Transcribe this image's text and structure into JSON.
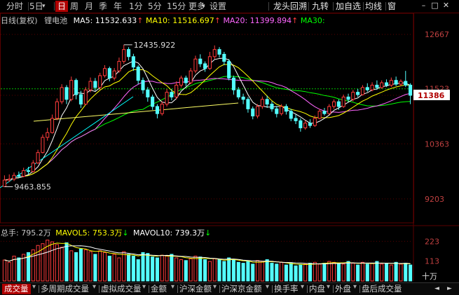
{
  "toolbar": {
    "left_items": [
      {
        "label": "分时",
        "x": 9
      },
      {
        "label": "5日",
        "x": 42
      },
      {
        "label": "日",
        "x": 79,
        "active": true
      },
      {
        "label": "周",
        "x": 100
      },
      {
        "label": "月",
        "x": 121
      },
      {
        "label": "季",
        "x": 141
      },
      {
        "label": "年",
        "x": 162
      },
      {
        "label": "1分",
        "x": 184
      },
      {
        "label": "5分",
        "x": 211
      },
      {
        "label": "15分",
        "x": 238
      },
      {
        "label": "更多",
        "x": 269
      },
      {
        "label": "设置",
        "x": 299
      }
    ],
    "right_items": [
      {
        "label": "龙头回溯",
        "x": 390
      },
      {
        "label": "九转",
        "x": 445
      },
      {
        "label": "加自选",
        "x": 479
      },
      {
        "label": "均线",
        "x": 521
      },
      {
        "label": "窗",
        "x": 553
      }
    ],
    "chevron": "▾"
  },
  "legend": {
    "title": "日线(复权)",
    "stock": "锂电池",
    "ma5_label": "MA5: 11532.633",
    "ma10_label": "MA10: 11516.697",
    "ma20_label": "MA20: 11399.894",
    "ma30_label": "MA30:",
    "arrow_up": "↑",
    "ma5_color": "#ffffff",
    "ma10_color": "#ffff00",
    "ma20_color": "#ff66ff",
    "ma30_color": "#00ff00"
  },
  "price_axis": {
    "labels": [
      "12667",
      "11386",
      "10363",
      "9203"
    ],
    "current": "11386",
    "ref_label": "11523"
  },
  "annotations": {
    "high": "12435.922",
    "low": "9463.855"
  },
  "volume_legend": {
    "total": "总手: 795.2万",
    "mavol5": "MAVOL5: 753.3万",
    "mavol10": "MAVOL10: 739.3万",
    "arrow_down": "↓",
    "axis": [
      "223",
      "113",
      "十万"
    ]
  },
  "tabs": [
    "成交量",
    "多周期成交量",
    "虚拟成交量",
    "金额",
    "沪深金额",
    "沪深京金额",
    "换手率",
    "内盘",
    "外盘",
    "盘后成交量"
  ],
  "colors": {
    "up": "#ff3c3c",
    "down": "#54ffff",
    "grid": "#5a0000",
    "axis_text": "#c04040"
  },
  "chart_data": {
    "type": "candlestick",
    "title": "锂电池",
    "y_ticks": [
      12667,
      11386,
      10363,
      9203
    ],
    "y_range": [
      8700,
      12950
    ],
    "volume_ticks": [
      223,
      113
    ],
    "volume_unit": "十万",
    "candles": [
      [
        9465,
        9600,
        9700,
        9460
      ],
      [
        9600,
        9620,
        9720,
        9560
      ],
      [
        9620,
        9700,
        9760,
        9580
      ],
      [
        9700,
        9680,
        9780,
        9640
      ],
      [
        9680,
        9800,
        9860,
        9660
      ],
      [
        9800,
        9780,
        9880,
        9720
      ],
      [
        9780,
        9960,
        10020,
        9760
      ],
      [
        9960,
        10180,
        10240,
        9940
      ],
      [
        10180,
        10500,
        10560,
        10160
      ],
      [
        10500,
        10600,
        10700,
        10430
      ],
      [
        10600,
        10900,
        10980,
        10580
      ],
      [
        10900,
        11250,
        11320,
        10860
      ],
      [
        11250,
        11550,
        11620,
        11200
      ],
      [
        11550,
        11300,
        11600,
        11200
      ],
      [
        11300,
        11700,
        11780,
        11260
      ],
      [
        11700,
        11400,
        11740,
        11300
      ],
      [
        11400,
        11200,
        11480,
        11120
      ],
      [
        11200,
        11500,
        11560,
        11180
      ],
      [
        11500,
        11680,
        11760,
        11450
      ],
      [
        11680,
        11550,
        11750,
        11480
      ],
      [
        11550,
        11800,
        11860,
        11500
      ],
      [
        11800,
        11950,
        12020,
        11760
      ],
      [
        11950,
        11750,
        11990,
        11680
      ],
      [
        11750,
        11900,
        11960,
        11700
      ],
      [
        11900,
        12100,
        12180,
        11860
      ],
      [
        12100,
        12350,
        12450,
        12050
      ],
      [
        12350,
        12200,
        12400,
        12120
      ],
      [
        12200,
        11980,
        12260,
        11900
      ],
      [
        11980,
        11700,
        12020,
        11620
      ],
      [
        11700,
        11500,
        11760,
        11420
      ],
      [
        11500,
        11350,
        11560,
        11250
      ],
      [
        11350,
        11150,
        11400,
        11080
      ],
      [
        11150,
        11000,
        11200,
        10900
      ],
      [
        11000,
        11200,
        11260,
        10960
      ],
      [
        11200,
        11450,
        11520,
        11150
      ],
      [
        11450,
        11350,
        11520,
        11280
      ],
      [
        11350,
        11600,
        11680,
        11300
      ],
      [
        11600,
        11750,
        11800,
        11550
      ],
      [
        11750,
        11650,
        11800,
        11580
      ],
      [
        11650,
        11900,
        11960,
        11620
      ],
      [
        11900,
        12150,
        12220,
        11850
      ],
      [
        12150,
        12050,
        12250,
        11980
      ],
      [
        12050,
        11950,
        12100,
        11880
      ],
      [
        11950,
        12200,
        12300,
        11920
      ],
      [
        12200,
        12350,
        12436,
        12150
      ],
      [
        12350,
        12250,
        12400,
        12180
      ],
      [
        12250,
        12100,
        12300,
        12020
      ],
      [
        12100,
        11750,
        12150,
        11700
      ],
      [
        11750,
        11500,
        11800,
        11400
      ],
      [
        11500,
        11350,
        11560,
        11300
      ],
      [
        11350,
        11300,
        11420,
        11200
      ],
      [
        11300,
        11100,
        11350,
        11020
      ],
      [
        11100,
        10950,
        11150,
        10880
      ],
      [
        10950,
        11150,
        11200,
        10900
      ],
      [
        11150,
        11300,
        11360,
        11100
      ],
      [
        11300,
        11200,
        11380,
        11120
      ],
      [
        11200,
        11100,
        11260,
        11040
      ],
      [
        11100,
        11000,
        11160,
        10920
      ],
      [
        11000,
        11150,
        11200,
        10960
      ],
      [
        11150,
        11050,
        11200,
        10980
      ],
      [
        11050,
        10900,
        11100,
        10840
      ],
      [
        10900,
        10850,
        10980,
        10780
      ],
      [
        10850,
        10700,
        10900,
        10620
      ],
      [
        10700,
        10800,
        10860,
        10660
      ],
      [
        10800,
        10750,
        10880,
        10700
      ],
      [
        10750,
        10900,
        10960,
        10720
      ],
      [
        10900,
        11050,
        11100,
        10880
      ],
      [
        11050,
        11000,
        11120,
        10960
      ],
      [
        11000,
        11150,
        11200,
        10980
      ],
      [
        11150,
        11250,
        11300,
        11100
      ],
      [
        11250,
        11150,
        11300,
        11080
      ],
      [
        11150,
        11350,
        11400,
        11120
      ],
      [
        11350,
        11300,
        11420,
        11250
      ],
      [
        11300,
        11450,
        11500,
        11260
      ],
      [
        11450,
        11400,
        11520,
        11350
      ],
      [
        11400,
        11550,
        11600,
        11380
      ],
      [
        11550,
        11500,
        11640,
        11460
      ],
      [
        11500,
        11600,
        11660,
        11470
      ],
      [
        11600,
        11550,
        11700,
        11500
      ],
      [
        11550,
        11650,
        11700,
        11520
      ],
      [
        11650,
        11600,
        11720,
        11560
      ],
      [
        11600,
        11700,
        11760,
        11560
      ],
      [
        11700,
        11620,
        11780,
        11580
      ],
      [
        11620,
        11680,
        11720,
        11580
      ],
      [
        11680,
        11600,
        11900,
        11560
      ],
      [
        11600,
        11386,
        11640,
        11200
      ]
    ],
    "volumes": [
      118,
      105,
      140,
      130,
      150,
      160,
      175,
      200,
      210,
      230,
      220,
      205,
      190,
      215,
      170,
      160,
      180,
      175,
      165,
      150,
      170,
      160,
      140,
      150,
      130,
      165,
      150,
      140,
      120,
      160,
      155,
      135,
      130,
      145,
      140,
      150,
      130,
      120,
      115,
      125,
      140,
      135,
      120,
      110,
      125,
      120,
      110,
      130,
      120,
      105,
      100,
      110,
      95,
      115,
      110,
      120,
      100,
      95,
      105,
      90,
      100,
      85,
      90,
      95,
      100,
      105,
      95,
      100,
      110,
      105,
      100,
      95,
      110,
      100,
      90,
      105,
      95,
      100,
      110,
      95,
      100,
      90,
      105,
      95,
      100,
      90
    ]
  }
}
